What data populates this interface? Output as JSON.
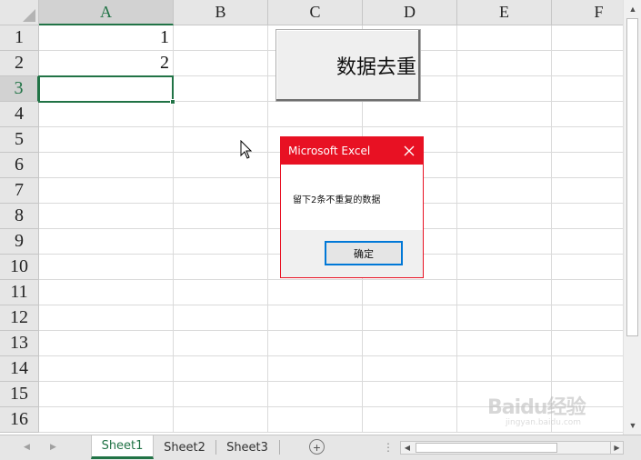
{
  "grid": {
    "columns": [
      "A",
      "B",
      "C",
      "D",
      "E",
      "F"
    ],
    "selected_column": "A",
    "rows": [
      "1",
      "2",
      "3",
      "4",
      "5",
      "6",
      "7",
      "8",
      "9",
      "10",
      "11",
      "12",
      "13",
      "14",
      "15",
      "16"
    ],
    "selected_row": "3",
    "cells": {
      "A1": "1",
      "A2": "2"
    },
    "active_cell": "A3"
  },
  "dedupe_button": {
    "label": "数据去重"
  },
  "msgbox": {
    "title": "Microsoft Excel",
    "message": "留下2条不重复的数据",
    "ok_label": "确定",
    "accent_color": "#e81123"
  },
  "sheets": {
    "tabs": [
      "Sheet1",
      "Sheet2",
      "Sheet3"
    ],
    "active": "Sheet1",
    "add_icon": "plus-circle-icon"
  },
  "watermark": {
    "logo": "Baidu经验",
    "sub": "jingyan.baidu.com"
  },
  "colors": {
    "excel_green": "#217346",
    "header_bg": "#e6e6e6",
    "gridline": "#dadada"
  }
}
